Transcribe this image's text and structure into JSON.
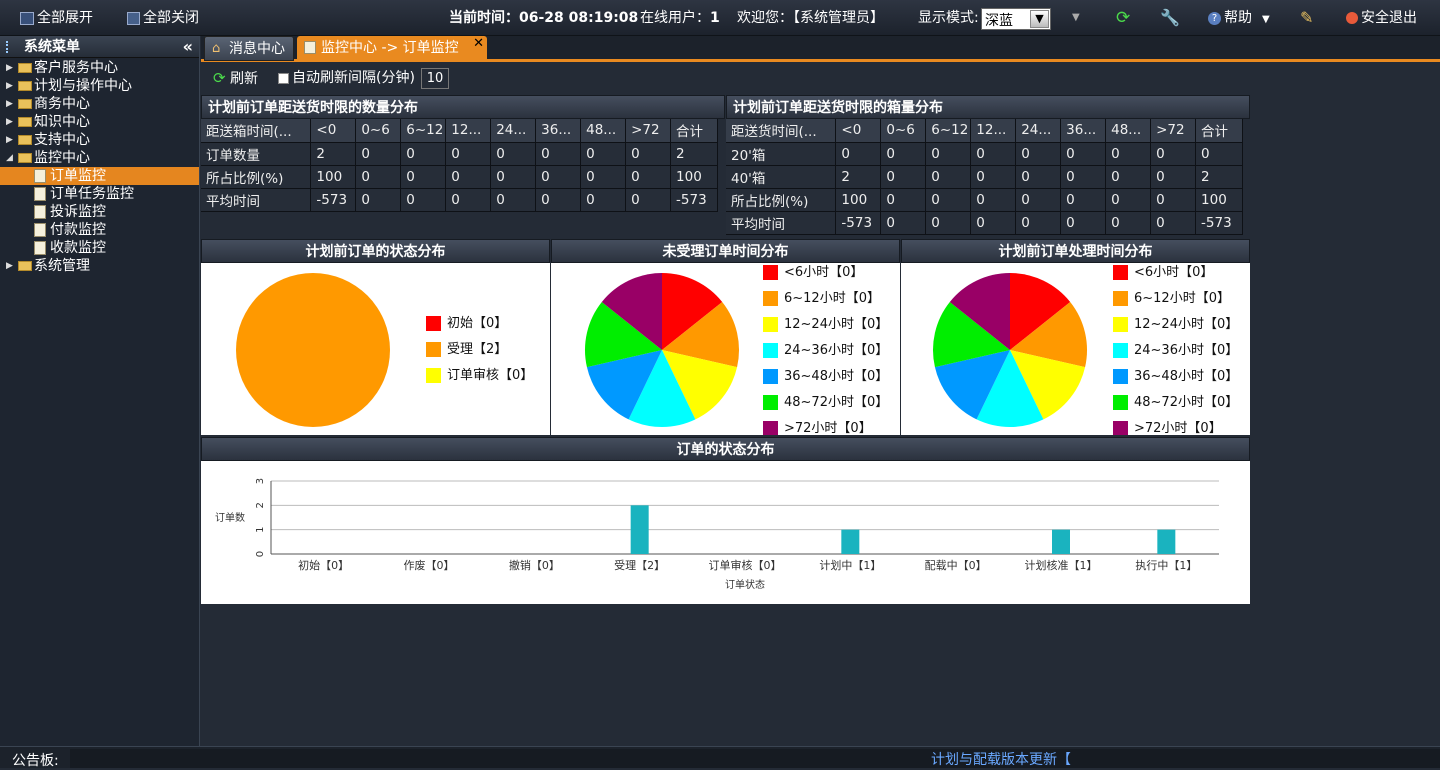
{
  "topbar": {
    "expand_all": "全部展开",
    "collapse_all": "全部关闭",
    "time_label": "当前时间：",
    "time_value": "06-28 08:19:08",
    "online_label": "在线用户：",
    "online_value": "1",
    "welcome": "欢迎您：【系统管理员】",
    "display_mode_label": "显示模式:",
    "display_mode_value": "深蓝",
    "help": "帮助",
    "logout": "安全退出"
  },
  "sidebar": {
    "title": "系统菜单",
    "items": [
      {
        "label": "客户服务中心"
      },
      {
        "label": "计划与操作中心"
      },
      {
        "label": "商务中心"
      },
      {
        "label": "知识中心"
      },
      {
        "label": "支持中心"
      },
      {
        "label": "监控中心"
      },
      {
        "label": "订单监控"
      },
      {
        "label": "订单任务监控"
      },
      {
        "label": "投诉监控"
      },
      {
        "label": "付款监控"
      },
      {
        "label": "收款监控"
      },
      {
        "label": "系统管理"
      }
    ]
  },
  "tabs": [
    {
      "label": "消息中心"
    },
    {
      "label": "监控中心 -> 订单监控"
    }
  ],
  "toolbar": {
    "refresh": "刷新",
    "auto_refresh": "自动刷新间隔(分钟)",
    "interval": "10"
  },
  "table1": {
    "title": "计划前订单距送货时限的数量分布",
    "headers": [
      "距送箱时间(...",
      "<0",
      "0~6",
      "6~12",
      "12...",
      "24...",
      "36...",
      "48...",
      ">72",
      "合计"
    ],
    "rows": [
      [
        "订单数量",
        "2",
        "0",
        "0",
        "0",
        "0",
        "0",
        "0",
        "0",
        "2"
      ],
      [
        "所占比例(%)",
        "100",
        "0",
        "0",
        "0",
        "0",
        "0",
        "0",
        "0",
        "100"
      ],
      [
        "平均时间",
        "-573",
        "0",
        "0",
        "0",
        "0",
        "0",
        "0",
        "0",
        "-573"
      ]
    ]
  },
  "table2": {
    "title": "计划前订单距送货时限的箱量分布",
    "headers": [
      "距送货时间(...",
      "<0",
      "0~6",
      "6~12",
      "12...",
      "24...",
      "36...",
      "48...",
      ">72",
      "合计"
    ],
    "rows": [
      [
        "20'箱",
        "0",
        "0",
        "0",
        "0",
        "0",
        "0",
        "0",
        "0",
        "0"
      ],
      [
        "40'箱",
        "2",
        "0",
        "0",
        "0",
        "0",
        "0",
        "0",
        "0",
        "2"
      ],
      [
        "所占比例(%)",
        "100",
        "0",
        "0",
        "0",
        "0",
        "0",
        "0",
        "0",
        "100"
      ],
      [
        "平均时间",
        "-573",
        "0",
        "0",
        "0",
        "0",
        "0",
        "0",
        "0",
        "-573"
      ]
    ]
  },
  "chart_data": [
    {
      "type": "pie",
      "title": "计划前订单的状态分布",
      "categories": [
        "初始【0】",
        "受理【2】",
        "订单审核【0】"
      ],
      "values": [
        0,
        2,
        0
      ],
      "colors": [
        "#ff0000",
        "#ff9900",
        "#ffff00"
      ]
    },
    {
      "type": "pie",
      "title": "未受理订单时间分布",
      "categories": [
        "<6小时【0】",
        "6~12小时【0】",
        "12~24小时【0】",
        "24~36小时【0】",
        "36~48小时【0】",
        "48~72小时【0】",
        ">72小时【0】"
      ],
      "values": [
        0,
        0,
        0,
        0,
        0,
        0,
        0
      ],
      "colors": [
        "#ff0000",
        "#ff9900",
        "#ffff00",
        "#00ffff",
        "#0099ff",
        "#00ee00",
        "#990066"
      ]
    },
    {
      "type": "pie",
      "title": "计划前订单处理时间分布",
      "categories": [
        "<6小时【0】",
        "6~12小时【0】",
        "12~24小时【0】",
        "24~36小时【0】",
        "36~48小时【0】",
        "48~72小时【0】",
        ">72小时【0】"
      ],
      "values": [
        0,
        0,
        0,
        0,
        0,
        0,
        0
      ],
      "colors": [
        "#ff0000",
        "#ff9900",
        "#ffff00",
        "#00ffff",
        "#0099ff",
        "#00ee00",
        "#990066"
      ]
    },
    {
      "type": "bar",
      "title": "订单的状态分布",
      "categories": [
        "初始【0】",
        "作废【0】",
        "撤销【0】",
        "受理【2】",
        "订单审核【0】",
        "计划中【1】",
        "配载中【0】",
        "计划核准【1】",
        "执行中【1】"
      ],
      "values": [
        0,
        0,
        0,
        2,
        0,
        1,
        0,
        1,
        1
      ],
      "xlabel": "订单状态",
      "ylabel": "订单数",
      "ylim": [
        0,
        3
      ],
      "yticks": [
        "0",
        "1",
        "2",
        "3"
      ],
      "color": "#1ab3bf"
    }
  ],
  "notice": {
    "label": "公告板:",
    "text": "计划与配载版本更新【"
  }
}
